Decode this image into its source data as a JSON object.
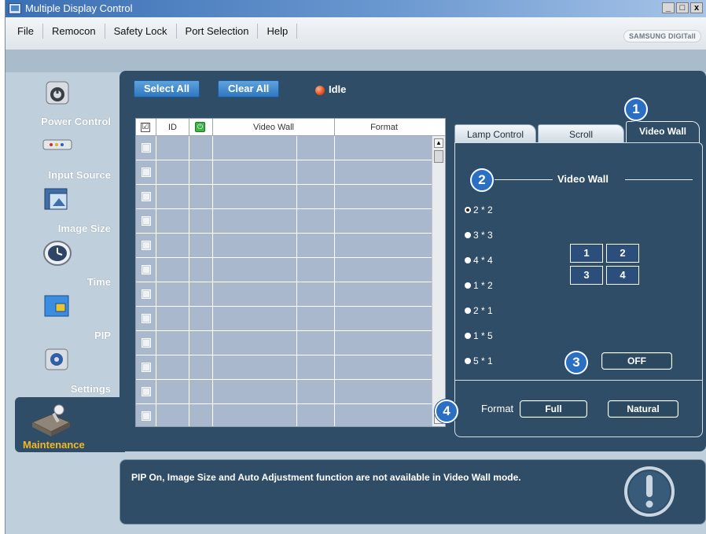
{
  "window": {
    "title": "Multiple Display Control",
    "controls": [
      "_",
      "□",
      "x"
    ]
  },
  "menu": {
    "items": [
      "File",
      "Remocon",
      "Safety Lock",
      "Port Selection",
      "Help"
    ],
    "brand": "SAMSUNG DIGITall"
  },
  "sidebar": {
    "items": [
      {
        "label": "Power Control",
        "icon": "power-icon"
      },
      {
        "label": "Input Source",
        "icon": "input-source-icon"
      },
      {
        "label": "Image Size",
        "icon": "image-size-icon"
      },
      {
        "label": "Time",
        "icon": "clock-icon"
      },
      {
        "label": "PIP",
        "icon": "pip-icon"
      },
      {
        "label": "Settings",
        "icon": "settings-icon"
      },
      {
        "label": "Maintenance",
        "icon": "maintenance-icon"
      }
    ]
  },
  "toolbar": {
    "select_all": "Select All",
    "clear_all": "Clear All",
    "status": "Idle"
  },
  "grid": {
    "headers": [
      "ID",
      "Video Wall",
      "Format"
    ],
    "check_glyph": "☑",
    "power_glyph": "⏻",
    "row_count": 12
  },
  "tabs": {
    "lamp_control": "Lamp Control",
    "scroll": "Scroll",
    "video_wall": "Video Wall"
  },
  "video_wall": {
    "group_title": "Video Wall",
    "options": [
      "2 * 2",
      "3 * 3",
      "4 * 4",
      "1 * 2",
      "2 * 1",
      "1 * 5",
      "5 * 1"
    ],
    "selected": "2 * 2",
    "preview_cells": [
      "1",
      "2",
      "3",
      "4"
    ],
    "toggle_label": "OFF",
    "format_label": "Format",
    "format_full": "Full",
    "format_natural": "Natural"
  },
  "callouts": [
    "1",
    "2",
    "3",
    "4"
  ],
  "message": "PIP On, Image Size and Auto Adjustment function are not available in Video Wall mode.",
  "colors": {
    "panel": "#2f4d66",
    "accent_button": "#2e77bf",
    "callout": "#2b6fc2",
    "grid_cell": "#a9b8cc",
    "maintenance_label": "#f3b826",
    "status_dot": "#e3410f"
  }
}
